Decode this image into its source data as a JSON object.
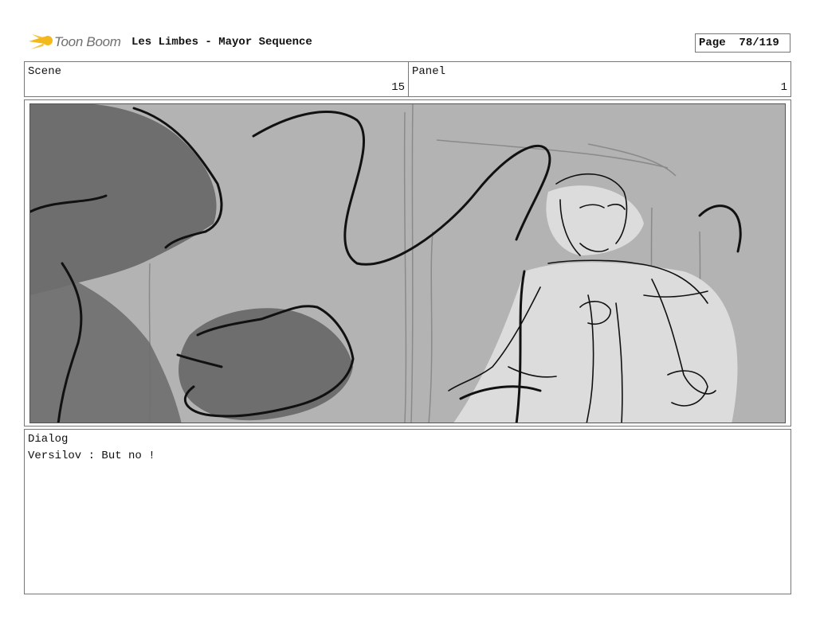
{
  "header": {
    "logo_text": "Toon Boom",
    "title": "Les Limbes - Mayor Sequence",
    "page_label": "Page",
    "page_value": "78/119"
  },
  "scene": {
    "label": "Scene",
    "value": "15"
  },
  "panel": {
    "label": "Panel",
    "value": "1"
  },
  "frame": {
    "icon": "storyboard-sketch-image",
    "colors": {
      "background": "#b3b3b3",
      "shadow": "#6e6e6e",
      "highlight": "#dcdcdc",
      "ink": "#111111"
    }
  },
  "dialog": {
    "label": "Dialog",
    "line": "Versilov : But no !"
  }
}
